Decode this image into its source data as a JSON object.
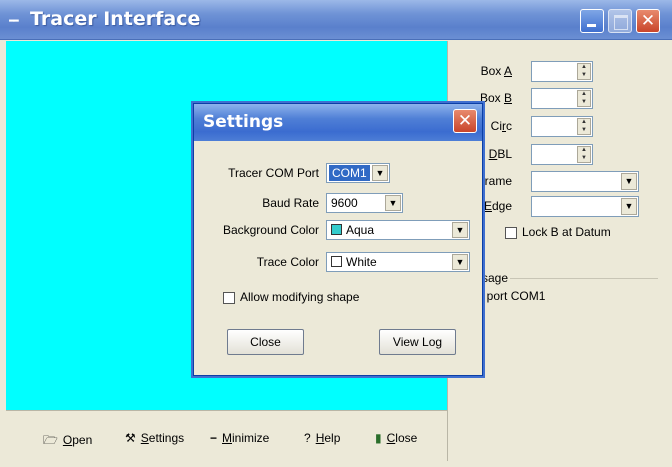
{
  "window": {
    "title": "Tracer Interface",
    "icon": "app-icon"
  },
  "canvas": {
    "background": "#00ffff"
  },
  "right_panel": {
    "fields": [
      {
        "label": "Box A",
        "accel": "A",
        "type": "spin",
        "value": ""
      },
      {
        "label": "Box B",
        "accel": "B",
        "type": "spin",
        "value": ""
      },
      {
        "label": "Circ",
        "accel": "r",
        "type": "spin",
        "value": ""
      },
      {
        "label": "DBL",
        "accel": "D",
        "type": "spin",
        "value": ""
      },
      {
        "label": "rame",
        "type": "combo",
        "value": ""
      },
      {
        "label": "Edge",
        "accel": "E",
        "type": "combo",
        "value": ""
      }
    ],
    "lock_checkbox": {
      "label": "Lock B at Datum",
      "checked": false
    },
    "message_group": {
      "title": "sage",
      "text": "on port COM1"
    }
  },
  "bottom_bar": {
    "items": [
      {
        "label": "Open",
        "accel": "O",
        "icon": "folder-open-icon"
      },
      {
        "label": "Settings",
        "accel": "S",
        "icon": "settings-icon"
      },
      {
        "label": "Minimize",
        "accel": "M",
        "icon": "minimize-icon"
      },
      {
        "label": "Help",
        "accel": "H",
        "icon": "help-icon"
      },
      {
        "label": "Close",
        "accel": "C",
        "icon": "close-door-icon"
      }
    ]
  },
  "settings_dialog": {
    "title": "Settings",
    "com_port": {
      "label": "Tracer COM Port",
      "value": "COM1"
    },
    "baud_rate": {
      "label": "Baud Rate",
      "value": "9600"
    },
    "background_color": {
      "label": "Background Color",
      "value": "Aqua",
      "swatch": "#33cccc"
    },
    "trace_color": {
      "label": "Trace Color",
      "value": "White",
      "swatch": "#ffffff"
    },
    "allow_modify": {
      "label": "Allow modifying shape",
      "checked": false
    },
    "close_button": "Close",
    "view_log_button": "View Log"
  }
}
